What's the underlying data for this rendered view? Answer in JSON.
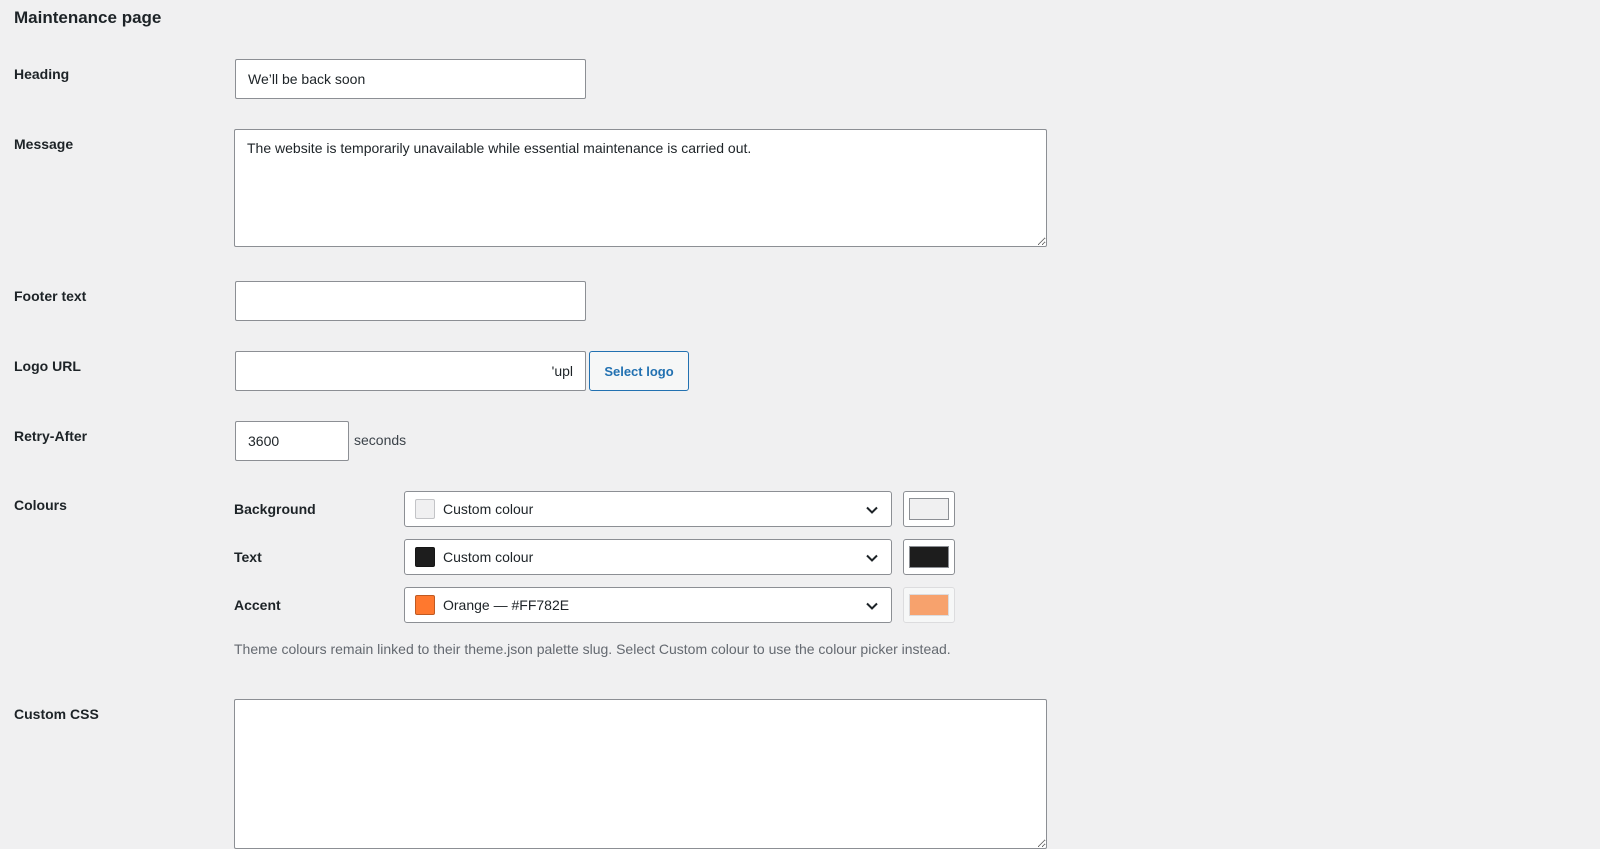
{
  "section": {
    "title": "Maintenance page"
  },
  "heading": {
    "label": "Heading",
    "value": "We’ll be back soon"
  },
  "message": {
    "label": "Message",
    "value": "The website is temporarily unavailable while essential maintenance is carried out."
  },
  "footer": {
    "label": "Footer text",
    "value": ""
  },
  "logo": {
    "label": "Logo URL",
    "value": "'upl",
    "button_label": "Select logo"
  },
  "retry": {
    "label": "Retry-After",
    "value": "3600",
    "unit": "seconds"
  },
  "colours": {
    "label": "Colours",
    "items": [
      {
        "label": "Background",
        "selected": "Custom colour",
        "swatch": "#f0f0f1",
        "picker_color": "#f0f0f1",
        "picker_enabled": true
      },
      {
        "label": "Text",
        "selected": "Custom colour",
        "swatch": "#1d1d1d",
        "picker_color": "#1d1d1d",
        "picker_enabled": true
      },
      {
        "label": "Accent",
        "selected": "Orange — #FF782E",
        "swatch": "#ff782e",
        "picker_color": "#f7a26d",
        "picker_enabled": false
      }
    ],
    "help": "Theme colours remain linked to their theme.json palette slug. Select Custom colour to use the colour picker instead."
  },
  "custom_css": {
    "label": "Custom CSS",
    "value": ""
  },
  "icons": {
    "dropdown": "chevron-down-icon"
  }
}
